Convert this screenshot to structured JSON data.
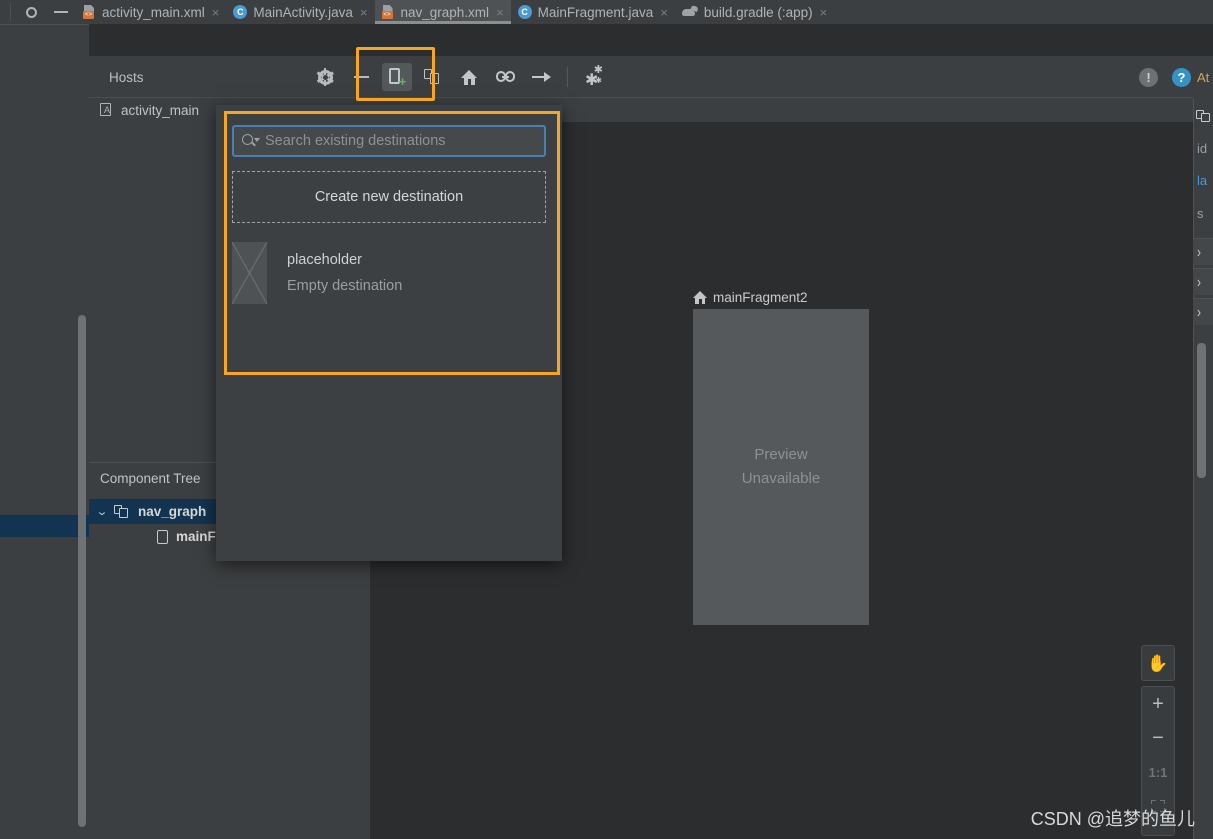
{
  "window": {
    "top_icons": [
      "gear-icon",
      "minimize-icon"
    ],
    "tabs": [
      {
        "label": "activity_main.xml",
        "icon": "xml-layout-icon",
        "active": false,
        "close": "×"
      },
      {
        "label": "MainActivity.java",
        "icon": "java-class-icon",
        "active": false,
        "close": "×"
      },
      {
        "label": "nav_graph.xml",
        "icon": "xml-navigation-icon",
        "active": true,
        "close": "×"
      },
      {
        "label": "MainFragment.java",
        "icon": "java-class-icon",
        "active": false,
        "close": "×"
      },
      {
        "label": "build.gradle (:app)",
        "icon": "gradle-icon",
        "active": false,
        "close": "×"
      }
    ]
  },
  "toolbar": {
    "hosts_label": "Hosts",
    "buttons": [
      {
        "name": "design-settings-button",
        "icon": "gear-icon"
      },
      {
        "name": "zoom-out-button",
        "icon": "dash-icon"
      },
      {
        "name": "new-destination-button",
        "icon": "new-destination-icon",
        "selected": true
      },
      {
        "name": "new-nested-graph-button",
        "icon": "nested-graph-icon"
      },
      {
        "name": "set-start-destination-button",
        "icon": "home-icon"
      },
      {
        "name": "add-deeplink-button",
        "icon": "link-icon"
      },
      {
        "name": "new-action-button",
        "icon": "arrow-right-icon"
      },
      {
        "name": "auto-arrange-button",
        "icon": "sparkle-icon"
      }
    ],
    "warning_icon": "!",
    "help_icon": "?"
  },
  "breadcrumb": {
    "icon": "android-layout-icon",
    "label": "activity_main"
  },
  "popup": {
    "search": {
      "placeholder": "Search existing destinations",
      "value": "",
      "icon": "search-icon"
    },
    "create_new_destination_label": "Create new destination",
    "destinations": [
      {
        "title": "placeholder",
        "subtitle": "Empty destination",
        "thumbnail": "empty-placeholder-icon"
      }
    ]
  },
  "component_tree": {
    "header": "Component Tree",
    "rows": [
      {
        "label": "nav_graph",
        "icon": "nav-graph-icon",
        "chevron": "⌄",
        "depth": 0,
        "selected": true
      },
      {
        "label": "mainFra",
        "icon": "fragment-icon",
        "chevron": "",
        "depth": 1,
        "selected": false
      }
    ]
  },
  "canvas": {
    "node": {
      "name": "mainFragment2",
      "start_icon": "home-icon",
      "preview_text_line1": "Preview",
      "preview_text_line2": "Unavailable"
    },
    "controls": {
      "pan": "✋",
      "zoom_in": "+",
      "zoom_out": "−",
      "zoom_actual": "1:1",
      "zoom_fit": "zoom-to-fit-icon"
    }
  },
  "attributes_panel": {
    "title": "At",
    "icon": "nav-graph-icon",
    "fields": [
      "id",
      "la",
      "s"
    ],
    "sections": [
      "›",
      "›",
      "›"
    ]
  },
  "watermark": "CSDN @追梦的鱼儿",
  "colors": {
    "accent_highlight": "#f5a623",
    "panel_bg": "#3c3f41",
    "canvas_bg": "#2b2d2e",
    "popup_bg": "#3c4043",
    "selection_blue": "#123450",
    "focus_border": "#4a7fb5",
    "help_blue": "#3592c4",
    "plus_green": "#62b562"
  }
}
